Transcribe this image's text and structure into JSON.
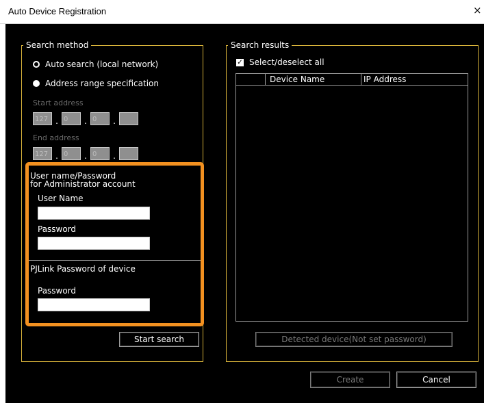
{
  "window": {
    "title": "Auto Device Registration",
    "close_icon": "×"
  },
  "search_method": {
    "legend": "Search method",
    "auto_search_label": "Auto search (local network)",
    "address_range_label": "Address range specification",
    "selected": "auto",
    "start_address_label": "Start address",
    "start_address": [
      "127",
      "0",
      "0",
      ""
    ],
    "end_address_label": "End address",
    "end_address": [
      "127",
      "0",
      "0",
      ""
    ]
  },
  "credentials": {
    "heading_line1": "User name/Password",
    "heading_line2": "for Administrator account",
    "user_name_label": "User Name",
    "user_name_value": "",
    "password_label": "Password",
    "password_value": "",
    "pjlink_heading": "PJLink Password of device",
    "pjlink_password_label": "Password",
    "pjlink_password_value": ""
  },
  "start_search_label": "Start search",
  "search_results": {
    "legend": "Search results",
    "select_all_label": "Select/deselect all",
    "select_all_checked": true,
    "columns": [
      "",
      "Device Name",
      "IP Address"
    ],
    "rows": []
  },
  "detected_device_label": "Detected device(Not set password)",
  "create_label": "Create",
  "cancel_label": "Cancel",
  "colors": {
    "background": "#000000",
    "group_border": "#d7b23a",
    "highlight": "#f39120"
  }
}
